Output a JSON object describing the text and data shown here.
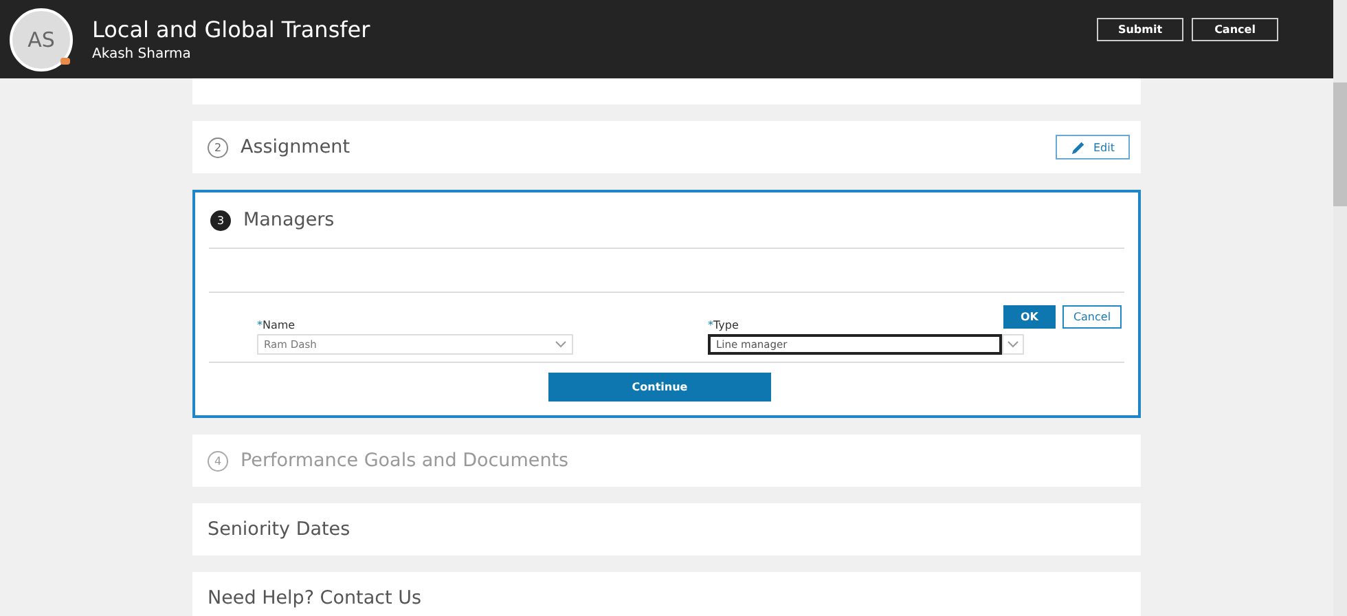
{
  "header": {
    "avatar_initials": "AS",
    "title": "Local and Global Transfer",
    "subtitle": "Akash Sharma",
    "buttons": [
      {
        "label": "Submit"
      },
      {
        "label": "Cancel"
      }
    ]
  },
  "sections": [
    {
      "number": "2",
      "title": "Assignment",
      "kind": "done",
      "edit_label": "Edit"
    },
    {
      "number": "3",
      "title": "Managers",
      "kind": "active",
      "ok_label": "OK",
      "cancel_label": "Cancel",
      "fields": [
        {
          "required_mark": "*",
          "label": "Name",
          "value": "Ram Dash",
          "focused": false
        },
        {
          "required_mark": "*",
          "label": "Type",
          "value": "Line manager",
          "focused": true
        }
      ],
      "continue_label": "Continue"
    },
    {
      "number": "4",
      "title": "Performance Goals and Documents",
      "kind": "upcoming"
    },
    {
      "title": "Seniority Dates",
      "kind": "plain"
    },
    {
      "title": "Need Help? Contact Us",
      "kind": "plain"
    }
  ]
}
